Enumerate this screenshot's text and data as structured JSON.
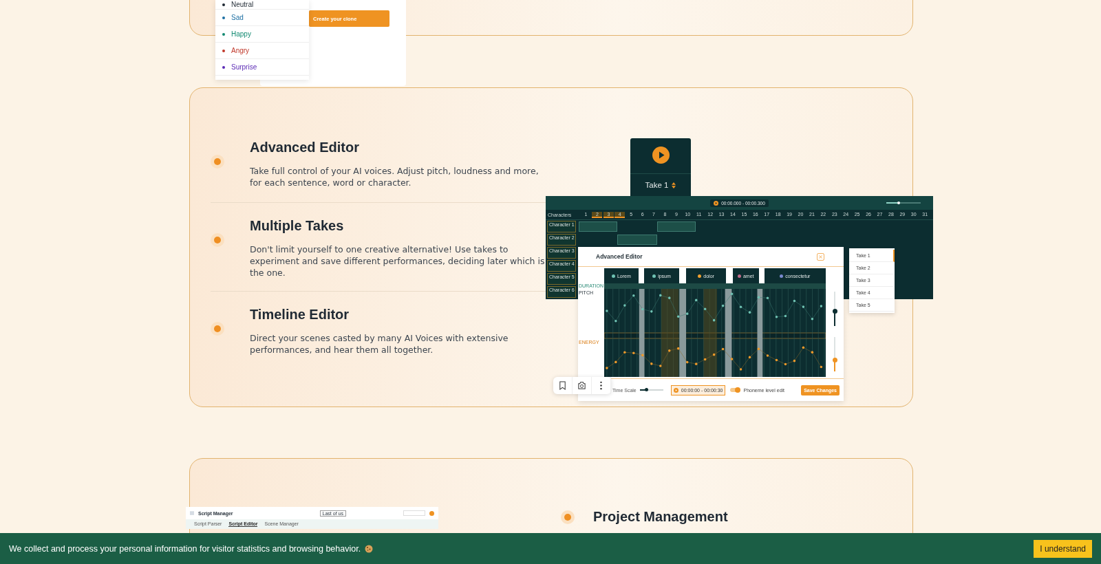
{
  "emotion_card": {
    "emotions": [
      {
        "label": "Neutral",
        "color": "#1f2933"
      },
      {
        "label": "Sad",
        "color": "#1d6fa3"
      },
      {
        "label": "Happy",
        "color": "#138a72"
      },
      {
        "label": "Angry",
        "color": "#c0392b"
      },
      {
        "label": "Surprise",
        "color": "#5b2bb5"
      }
    ],
    "button": "Create your clone"
  },
  "features": [
    {
      "title": "Advanced Editor",
      "description": "Take full control of your AI voices. Adjust pitch, loudness and more, for each sentence, word or character."
    },
    {
      "title": "Multiple Takes",
      "description": "Don't limit yourself to one creative alternative! Use takes to experiment and save different performances, deciding later which is the one."
    },
    {
      "title": "Timeline Editor",
      "description": "Direct your scenes casted by many AI Voices with extensive performances, and hear them all together."
    }
  ],
  "take_card": {
    "take": "Take 1"
  },
  "timeline": {
    "time_range": "00:00.000 - 00:00.300",
    "zoom_slider": {
      "level": 0.35
    },
    "header": "Characters",
    "ruler": [
      "1",
      "2",
      "3",
      "4",
      "5",
      "6",
      "7",
      "8",
      "9",
      "10",
      "11",
      "12",
      "13",
      "14",
      "15",
      "16",
      "17",
      "18",
      "19",
      "20",
      "21",
      "22",
      "23",
      "24",
      "25",
      "26",
      "27",
      "28",
      "29",
      "30",
      "31"
    ],
    "tracks": [
      "Character 1",
      "Character 2",
      "Character 3",
      "Character 4",
      "Character 5",
      "Character 6"
    ]
  },
  "editor": {
    "title": "Advanced Editor",
    "words": [
      {
        "label": "Lorem",
        "color": "#6fc2b3"
      },
      {
        "label": "ipsum",
        "color": "#6fc2b3"
      },
      {
        "label": "dolor",
        "color": "#f0a030"
      },
      {
        "label": "amet",
        "color": "#c06a8a"
      },
      {
        "label": "consectetur",
        "color": "#7a8ad0"
      }
    ],
    "rows": [
      "DURATION",
      "PITCH",
      "ENERGY"
    ],
    "pitch_slider": {
      "level": 0.45
    },
    "energy_slider": {
      "level": 0.35
    },
    "scale_label": "Time Scale",
    "scale_slider": {
      "level": 0.3
    },
    "time_range": "00:00:00 - 00:00:30",
    "phoneme_toggle": {
      "label": "Phoneme level edit",
      "on": true
    },
    "save": "Save Changes"
  },
  "takes": [
    {
      "label": "Take 1",
      "selected": true
    },
    {
      "label": "Take 2",
      "selected": false
    },
    {
      "label": "Take 3",
      "selected": false
    },
    {
      "label": "Take 4",
      "selected": false
    },
    {
      "label": "Take 5",
      "selected": false
    }
  ],
  "project_card": {
    "heading": "Project Management",
    "script_manager": {
      "title": "Script Manager",
      "project": "Last of us",
      "tabs": [
        {
          "label": "Script Parser",
          "selected": false
        },
        {
          "label": "Script Editor",
          "selected": true
        },
        {
          "label": "Scene Manager",
          "selected": false
        }
      ]
    }
  },
  "cookie_bar": {
    "message": "We collect and process your personal information for visitor statistics and browsing behavior.",
    "button": "I understand"
  }
}
